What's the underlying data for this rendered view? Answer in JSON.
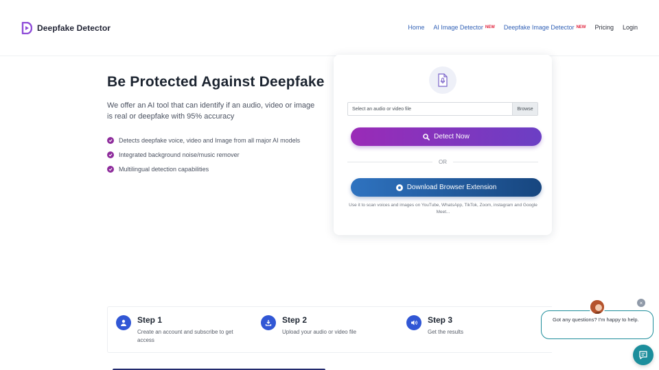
{
  "header": {
    "brand": "Deepfake Detector",
    "nav": [
      {
        "label": "Home",
        "badge": ""
      },
      {
        "label": "AI Image Detector",
        "badge": "NEW"
      },
      {
        "label": "Deepfake Image Detector",
        "badge": "NEW"
      },
      {
        "label": "Pricing",
        "badge": ""
      },
      {
        "label": "Login",
        "badge": ""
      }
    ]
  },
  "hero": {
    "title": "Be Protected Against Deepfake",
    "description": "We offer an AI tool that can identify if an audio, video or image is real or deepfake with 95% accuracy",
    "features": [
      "Detects deepfake voice, video and Image from all major AI models",
      "Integrated background noise/music remover",
      "Multilingual detection capabilities"
    ]
  },
  "upload_card": {
    "file_placeholder": "Select an audio or video file",
    "browse_label": "Browse",
    "detect_label": "Detect Now",
    "or_label": "OR",
    "extension_label": "Download Browser Extension",
    "extension_note": "Use it to scan voices and images on YouTube, WhatsApp, TikTok, Zoom, instagram and Google Meet..."
  },
  "steps": [
    {
      "title": "Step 1",
      "desc": "Create an account and subscribe to get access",
      "icon": "user-icon"
    },
    {
      "title": "Step 2",
      "desc": "Upload your audio or video file",
      "icon": "download-icon"
    },
    {
      "title": "Step 3",
      "desc": "Get the results",
      "icon": "speaker-icon"
    }
  ],
  "chat": {
    "message": "Got any questions? I'm happy to help.",
    "close_label": "×"
  },
  "colors": {
    "brand_purple": "#8e2c9c",
    "detect_gradient_start": "#9a2bb7",
    "detect_gradient_end": "#6b3fc4",
    "extension_gradient_start": "#2f73c0",
    "extension_gradient_end": "#17467f",
    "nav_link": "#2f5fb5",
    "badge_red": "#e0203a",
    "step_icon_blue": "#3157d5",
    "chat_teal": "#1c8e9c"
  }
}
